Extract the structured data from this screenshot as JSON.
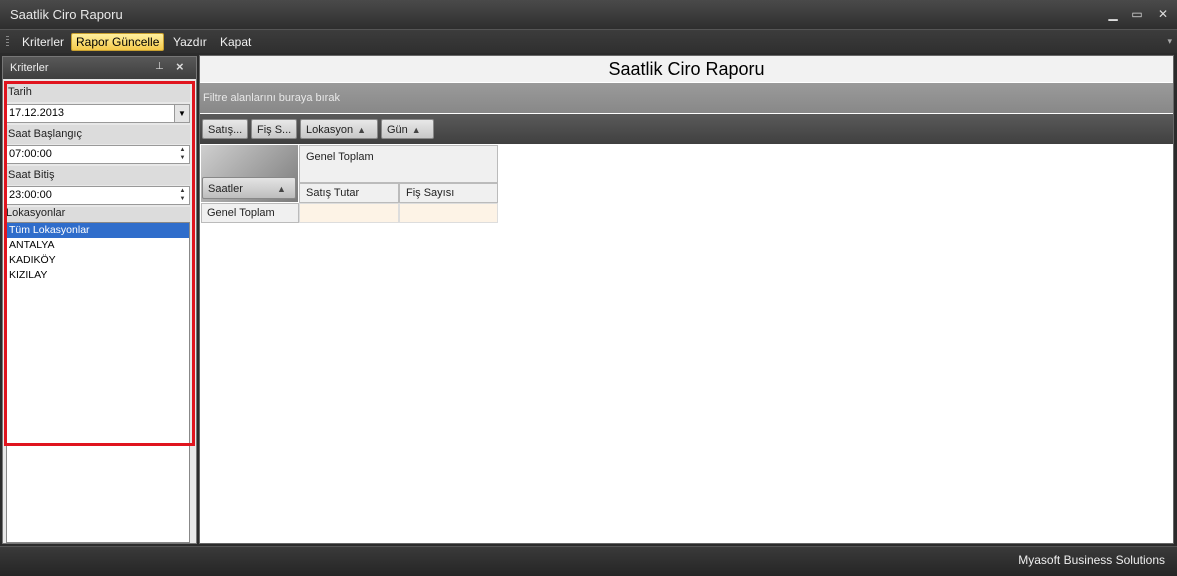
{
  "window": {
    "title": "Saatlik Ciro Raporu",
    "minimize_icon": "minimize-icon",
    "maximize_icon": "maximize-icon",
    "close_icon": "close-icon"
  },
  "menu": {
    "items": [
      {
        "label": "Kriterler"
      },
      {
        "label": "Rapor Güncelle"
      },
      {
        "label": "Yazdır"
      },
      {
        "label": "Kapat"
      }
    ]
  },
  "criteria_panel": {
    "title": "Kriterler",
    "date_label": "Tarih",
    "date_value": "17.12.2013",
    "start_label": "Saat Başlangıç",
    "start_value": "07:00:00",
    "end_label": "Saat Bitiş",
    "end_value": "23:00:00",
    "locations_label": "Lokasyonlar",
    "locations": [
      "Tüm Lokasyonlar",
      "ANTALYA",
      "KADIKÖY",
      "KIZILAY"
    ],
    "selected_location": "Tüm Lokasyonlar"
  },
  "report": {
    "title": "Saatlik Ciro Raporu",
    "filter_hint": "Filtre alanlarını buraya bırak",
    "field_buttons": [
      {
        "label": "Satış..."
      },
      {
        "label": "Fiş S..."
      },
      {
        "label": "Lokasyon"
      },
      {
        "label": "Gün"
      }
    ],
    "row_field": "Saatler",
    "column_total": "Genel Toplam",
    "data_headers": [
      "Satış Tutar",
      "Fiş Sayısı"
    ],
    "row_total": "Genel Toplam",
    "total_values": [
      "",
      ""
    ]
  },
  "status": {
    "text": "Myasoft Business Solutions"
  },
  "colors": {
    "highlight_frame": "#e0141e",
    "selected_item": "#2f6dcb",
    "active_menu": "#f5c94a"
  }
}
